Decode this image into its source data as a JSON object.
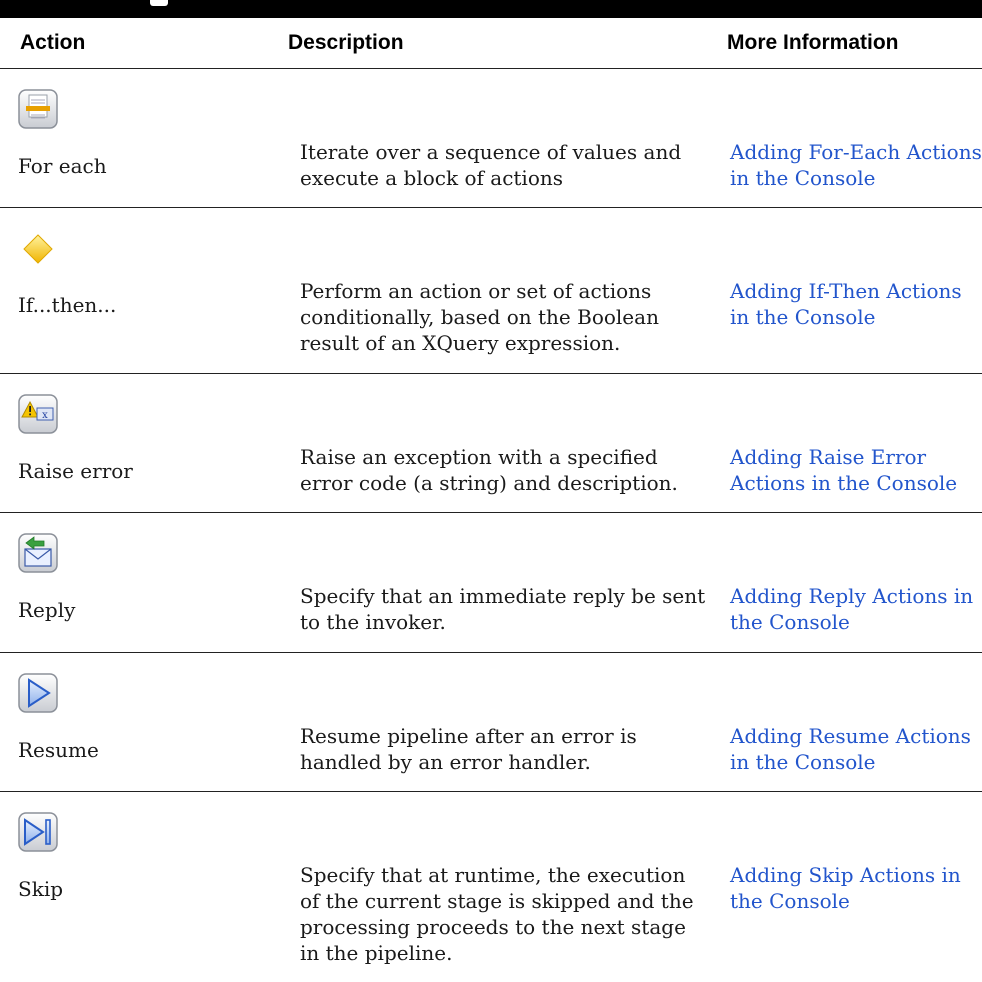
{
  "table": {
    "headers": {
      "action": "Action",
      "description": "Description",
      "more_information": "More Information"
    },
    "rows": [
      {
        "icon": "for-each-icon",
        "action": "For each",
        "description": "Iterate over a sequence of values and execute a block of actions",
        "link": "Adding For-Each Actions in the Console"
      },
      {
        "icon": "if-then-icon",
        "action": "If...then...",
        "description": "Perform an action or set of actions conditionally, based on the Boolean result of an XQuery expression.",
        "link": "Adding If-Then Actions in the Console"
      },
      {
        "icon": "raise-error-icon",
        "action": "Raise error",
        "description": "Raise an exception with a specified error code (a string) and description.",
        "link": "Adding Raise Error Actions in the Console"
      },
      {
        "icon": "reply-icon",
        "action": "Reply",
        "description": "Specify that an immediate reply be sent to the invoker.",
        "link": "Adding Reply Actions in the Console"
      },
      {
        "icon": "resume-icon",
        "action": "Resume",
        "description": "Resume pipeline after an error is handled by an error handler.",
        "link": "Adding Resume Actions in the Console"
      },
      {
        "icon": "skip-icon",
        "action": "Skip",
        "description": "Specify that at runtime, the execution of the current stage is skipped and the processing proceeds to the next stage in the pipeline.",
        "link": "Adding Skip Actions in the Console"
      }
    ]
  },
  "colors": {
    "link": "#2255cc",
    "header_bar": "#000000",
    "rule": "#222222"
  }
}
